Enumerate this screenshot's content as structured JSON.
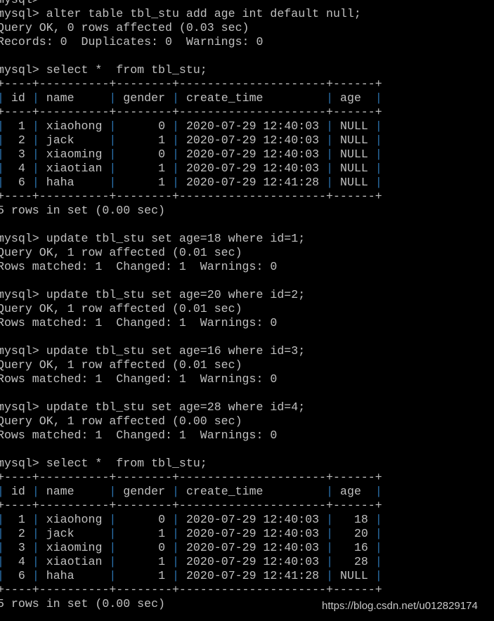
{
  "terminal": {
    "lines": [
      "mysql>",
      "mysql> alter table tbl_stu add age int default null;",
      "Query OK, 0 rows affected (0.03 sec)",
      "Records: 0  Duplicates: 0  Warnings: 0",
      "",
      "mysql> select *  from tbl_stu;",
      "+----+----------+--------+---------------------+------+",
      "| id | name     | gender | create_time         | age  |",
      "+----+----------+--------+---------------------+------+",
      "|  1 | xiaohong |      0 | 2020-07-29 12:40:03 | NULL |",
      "|  2 | jack     |      1 | 2020-07-29 12:40:03 | NULL |",
      "|  3 | xiaoming |      0 | 2020-07-29 12:40:03 | NULL |",
      "|  4 | xiaotian |      1 | 2020-07-29 12:40:03 | NULL |",
      "|  6 | haha     |      1 | 2020-07-29 12:41:28 | NULL |",
      "+----+----------+--------+---------------------+------+",
      "5 rows in set (0.00 sec)",
      "",
      "mysql> update tbl_stu set age=18 where id=1;",
      "Query OK, 1 row affected (0.01 sec)",
      "Rows matched: 1  Changed: 1  Warnings: 0",
      "",
      "mysql> update tbl_stu set age=20 where id=2;",
      "Query OK, 1 row affected (0.01 sec)",
      "Rows matched: 1  Changed: 1  Warnings: 0",
      "",
      "mysql> update tbl_stu set age=16 where id=3;",
      "Query OK, 1 row affected (0.01 sec)",
      "Rows matched: 1  Changed: 1  Warnings: 0",
      "",
      "mysql> update tbl_stu set age=28 where id=4;",
      "Query OK, 1 row affected (0.00 sec)",
      "Rows matched: 1  Changed: 1  Warnings: 0",
      "",
      "mysql> select *  from tbl_stu;",
      "+----+----------+--------+---------------------+------+",
      "| id | name     | gender | create_time         | age  |",
      "+----+----------+--------+---------------------+------+",
      "|  1 | xiaohong |      0 | 2020-07-29 12:40:03 |   18 |",
      "|  2 | jack     |      1 | 2020-07-29 12:40:03 |   20 |",
      "|  3 | xiaoming |      0 | 2020-07-29 12:40:03 |   16 |",
      "|  4 | xiaotian |      1 | 2020-07-29 12:40:03 |   28 |",
      "|  6 | haha     |      1 | 2020-07-29 12:41:28 | NULL |",
      "+----+----------+--------+---------------------+------+",
      "5 rows in set (0.00 sec)"
    ]
  },
  "watermark": "https://blog.csdn.net/u012829174",
  "colors": {
    "background": "#000000",
    "text": "#c0c0c0",
    "table_border": "#2b72ad"
  }
}
